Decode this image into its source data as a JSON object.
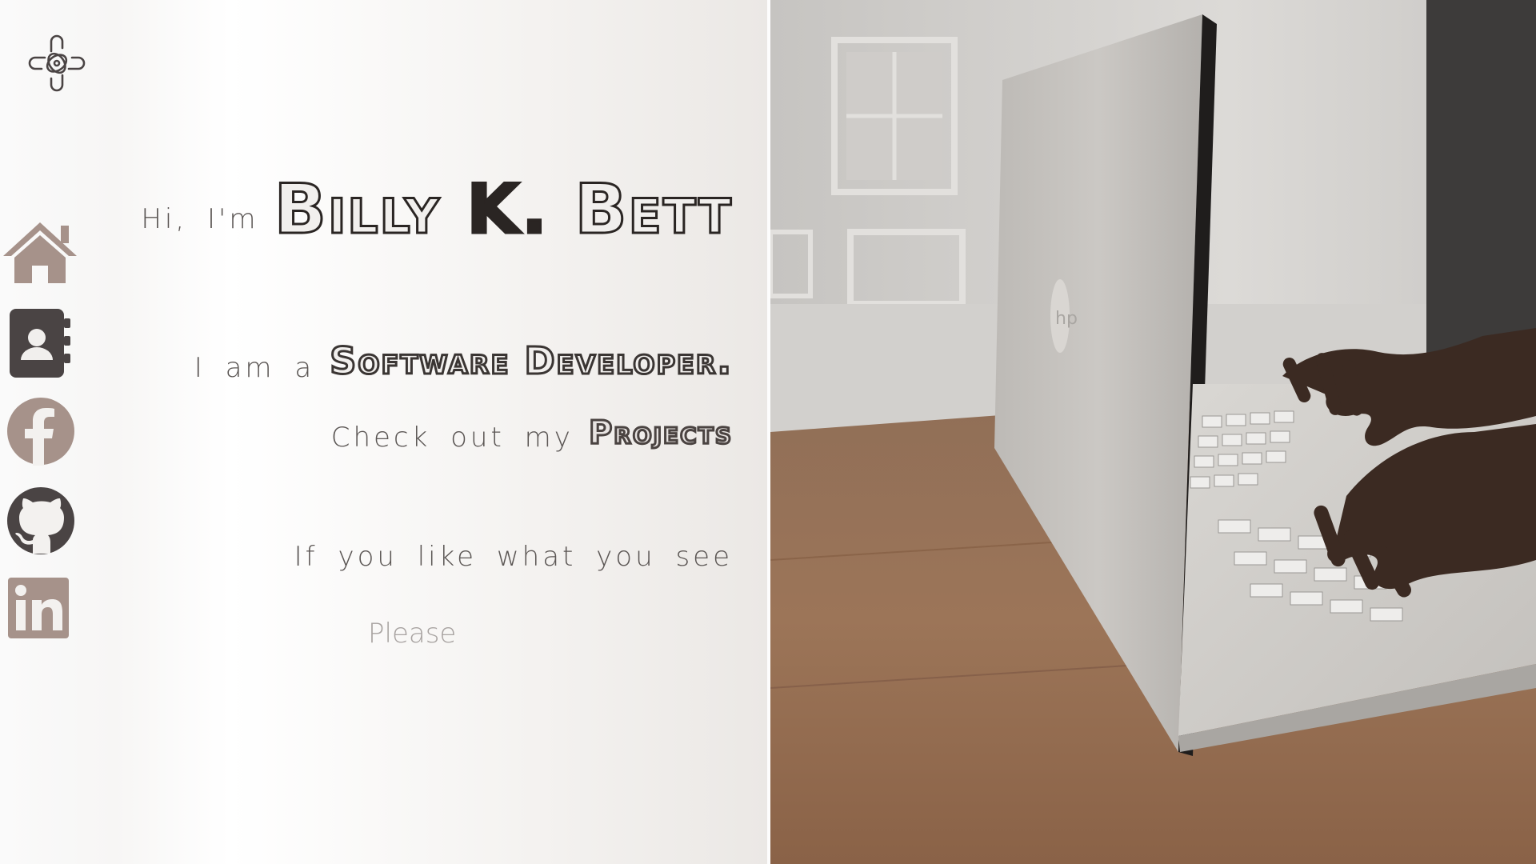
{
  "hero": {
    "greeting": "Hi, I'm",
    "name_first": "Billy",
    "name_initial": "K.",
    "name_last": "Bett",
    "role_prefix": "I am a",
    "role": "Software Developer.",
    "projects_prefix": "Check out my",
    "projects_link": "Projects",
    "like_text": "If you like what you see",
    "please_text": "Please"
  },
  "sidebar": {
    "items": [
      {
        "name": "home",
        "icon": "house-icon"
      },
      {
        "name": "contact",
        "icon": "contact-book-icon"
      },
      {
        "name": "facebook",
        "icon": "facebook-icon"
      },
      {
        "name": "github",
        "icon": "github-icon"
      },
      {
        "name": "linkedin",
        "icon": "linkedin-icon"
      }
    ]
  },
  "logo": {
    "icon": "knot-logo-icon"
  },
  "colors": {
    "icon_brown": "#a6928a",
    "icon_dark": "#4a4444",
    "text_dark": "#2a2523",
    "text_light": "#5b5654"
  }
}
